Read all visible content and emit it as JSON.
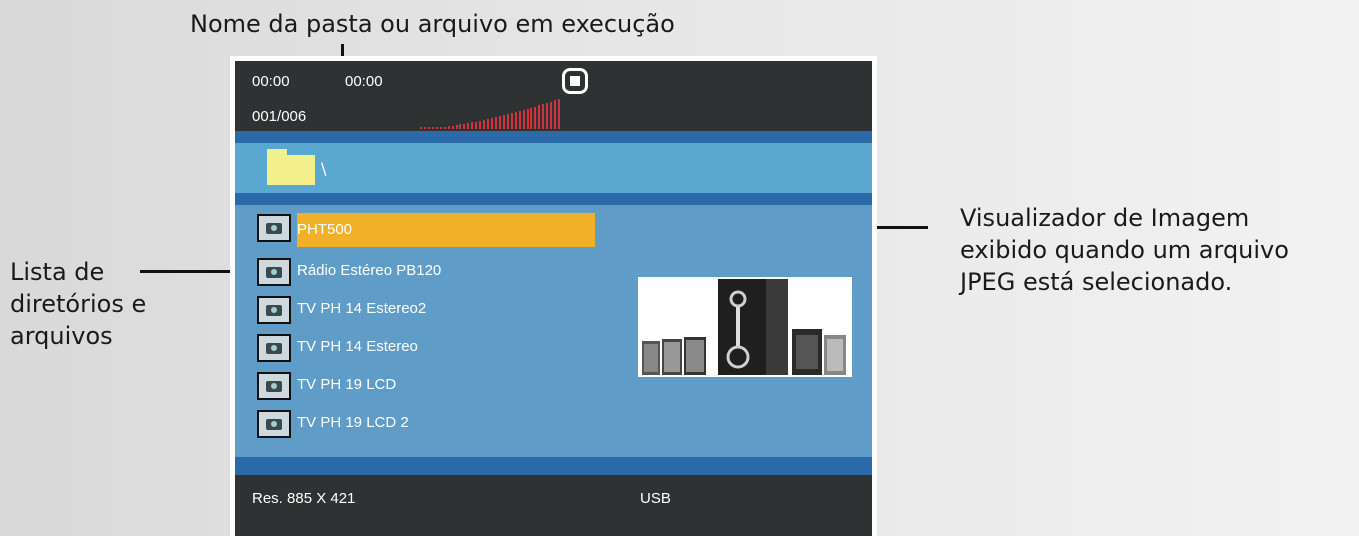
{
  "callouts": {
    "top": "Nome da pasta ou arquivo em execução",
    "left": [
      "Lista de",
      "diretórios e",
      "arquivos"
    ],
    "right": [
      "Visualizador de Imagem",
      "exibido quando um arquivo",
      "JPEG está selecionado."
    ]
  },
  "osd": {
    "time_elapsed": "00:00",
    "time_total": "00:00",
    "track_counter": "001/006",
    "volume_level": 1.0
  },
  "folder": {
    "path": "\\"
  },
  "files": [
    {
      "name": "PHT500",
      "selected": true
    },
    {
      "name": "Rádio Estéreo PB120",
      "selected": false
    },
    {
      "name": "TV PH 14 Estereo2",
      "selected": false
    },
    {
      "name": "TV PH 14 Estereo",
      "selected": false
    },
    {
      "name": "TV PH 19 LCD",
      "selected": false
    },
    {
      "name": "TV PH 19 LCD 2",
      "selected": false
    }
  ],
  "status": {
    "resolution": "Res.  885 X  421",
    "source": "USB"
  },
  "colors": {
    "osd_bar": "#2e3232",
    "list_bg": "#5f9cc8",
    "folder_bar": "#5aa7d2",
    "selection": "#f0b028",
    "volume": "#d2323c",
    "folder_icon": "#f3f08c"
  }
}
